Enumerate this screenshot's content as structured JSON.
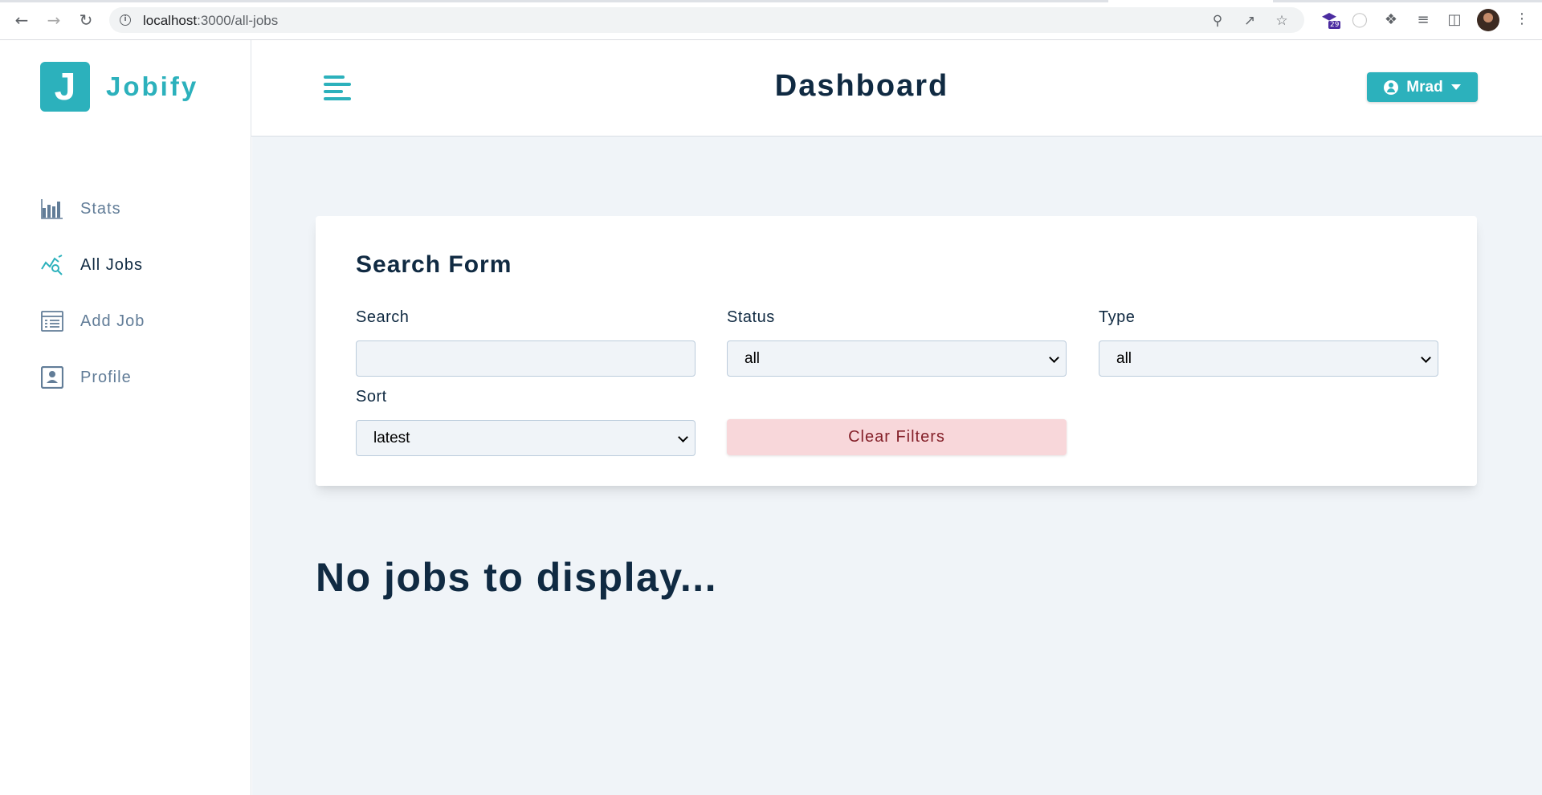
{
  "browser": {
    "back_icon": "arrow-left-icon",
    "forward_icon": "arrow-right-icon",
    "reload_icon": "reload-icon",
    "url_host": "localhost",
    "url_path": ":3000/all-jobs",
    "extension_badge": "29"
  },
  "sidebar": {
    "logo_letter": "J",
    "logo_text": "Jobify",
    "items": [
      {
        "label": "Stats",
        "icon": "stats-icon"
      },
      {
        "label": "All Jobs",
        "icon": "all-jobs-icon"
      },
      {
        "label": "Add Job",
        "icon": "add-job-icon"
      },
      {
        "label": "Profile",
        "icon": "profile-icon"
      }
    ],
    "active_item": "All Jobs"
  },
  "header": {
    "title": "Dashboard",
    "user_name": "Mrad"
  },
  "search_form": {
    "title": "Search Form",
    "search": {
      "label": "Search",
      "value": ""
    },
    "status": {
      "label": "Status",
      "selected": "all"
    },
    "type": {
      "label": "Type",
      "selected": "all"
    },
    "sort": {
      "label": "Sort",
      "selected": "latest"
    },
    "clear_label": "Clear Filters"
  },
  "jobs": {
    "empty_message": "No jobs to display..."
  },
  "colors": {
    "primary": "#2cb1bc",
    "background": "#f0f4f8",
    "text": "#102a42",
    "danger_light": "#f8d7da",
    "danger_dark": "#842029"
  }
}
